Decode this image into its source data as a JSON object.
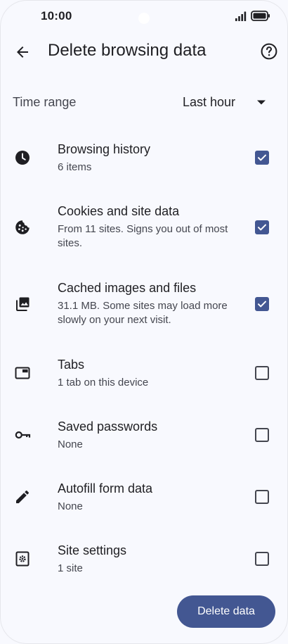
{
  "status_bar": {
    "time": "10:00"
  },
  "app_bar": {
    "title": "Delete browsing data",
    "back_icon": "arrow-back-icon",
    "help_icon": "help-circle-icon"
  },
  "time_range": {
    "label": "Time range",
    "value": "Last hour"
  },
  "items": [
    {
      "title": "Browsing history",
      "subtitle": "6 items",
      "icon": "clock-icon",
      "checked": true
    },
    {
      "title": "Cookies and site data",
      "subtitle": "From 11 sites. Signs you out of most sites.",
      "icon": "cookie-icon",
      "checked": true
    },
    {
      "title": "Cached images and files",
      "subtitle": "31.1 MB. Some sites may load more slowly on your next visit.",
      "icon": "image-stack-icon",
      "checked": true
    },
    {
      "title": "Tabs",
      "subtitle": "1 tab on this device",
      "icon": "tab-icon",
      "checked": false
    },
    {
      "title": "Saved passwords",
      "subtitle": "None",
      "icon": "key-icon",
      "checked": false
    },
    {
      "title": "Autofill form data",
      "subtitle": "None",
      "icon": "pencil-icon",
      "checked": false
    },
    {
      "title": "Site settings",
      "subtitle": "1 site",
      "icon": "site-settings-icon",
      "checked": false
    }
  ],
  "delete_button": {
    "label": "Delete data"
  },
  "colors": {
    "background": "#f8f9fe",
    "accent": "#435792",
    "text_primary": "#1f1f23",
    "text_secondary": "#44464f"
  }
}
